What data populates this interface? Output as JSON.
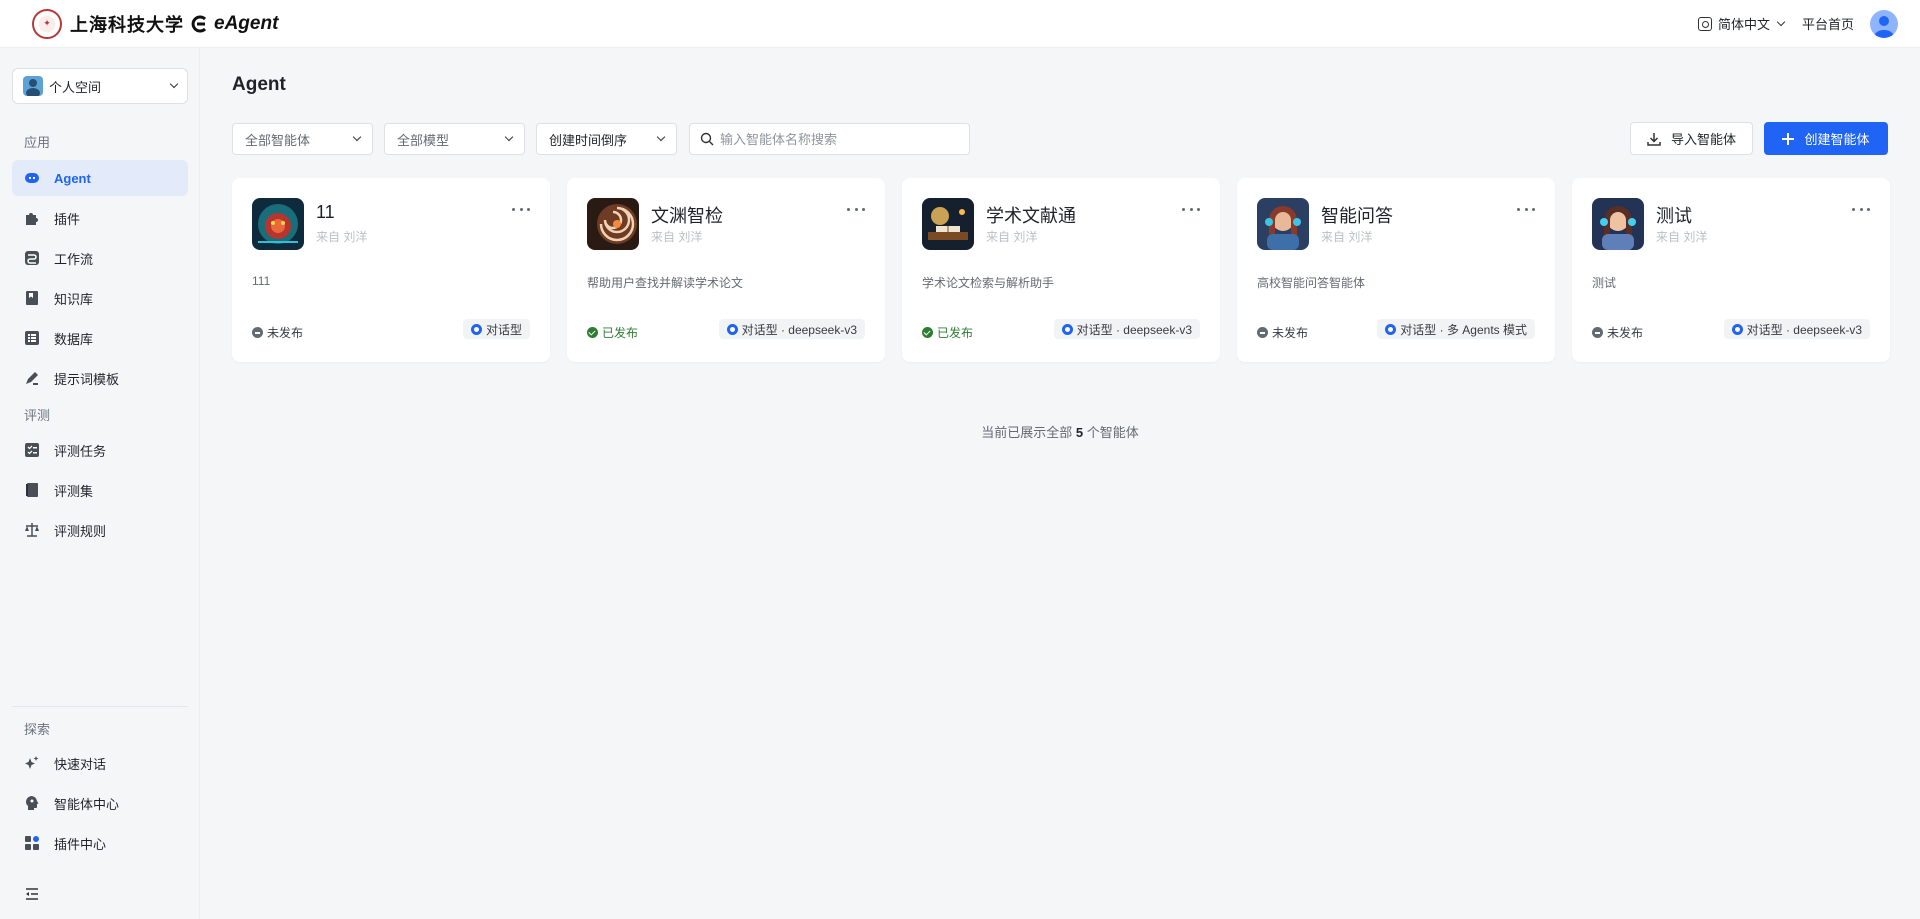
{
  "header": {
    "school_name": "上海科技大学",
    "product_name": "eAgent",
    "language": "简体中文",
    "home_link": "平台首页"
  },
  "sidebar": {
    "space_label": "个人空间",
    "section_app": "应用",
    "section_eval": "评测",
    "section_explore": "探索",
    "app_items": [
      {
        "label": "Agent",
        "icon": "robot-icon",
        "active": true
      },
      {
        "label": "插件",
        "icon": "puzzle-icon"
      },
      {
        "label": "工作流",
        "icon": "workflow-icon"
      },
      {
        "label": "知识库",
        "icon": "knowledge-icon"
      },
      {
        "label": "数据库",
        "icon": "database-icon"
      },
      {
        "label": "提示词模板",
        "icon": "prompt-icon"
      }
    ],
    "eval_items": [
      {
        "label": "评测任务",
        "icon": "eval-task-icon"
      },
      {
        "label": "评测集",
        "icon": "eval-set-icon"
      },
      {
        "label": "评测规则",
        "icon": "scale-icon"
      }
    ],
    "explore_items": [
      {
        "label": "快速对话",
        "icon": "sparkle-icon"
      },
      {
        "label": "智能体中心",
        "icon": "brain-icon"
      },
      {
        "label": "插件中心",
        "icon": "plugin-grid-icon"
      }
    ]
  },
  "main": {
    "title": "Agent",
    "filters": [
      "全部智能体",
      "全部模型",
      "创建时间倒序"
    ],
    "search_placeholder": "输入智能体名称搜索",
    "import_label": "导入智能体",
    "create_label": "创建智能体",
    "accent_color": "#1f64f5",
    "cards": [
      {
        "name": "11",
        "from": "来自 刘洋",
        "desc": "111",
        "status": "未发布",
        "published": false,
        "type": "对话型"
      },
      {
        "name": "文渊智检",
        "from": "来自 刘洋",
        "desc": "帮助用户查找并解读学术论文",
        "status": "已发布",
        "published": true,
        "type": "对话型 · deepseek-v3"
      },
      {
        "name": "学术文献通",
        "from": "来自 刘洋",
        "desc": "学术论文检索与解析助手",
        "status": "已发布",
        "published": true,
        "type": "对话型 · deepseek-v3"
      },
      {
        "name": "智能问答",
        "from": "来自 刘洋",
        "desc": "高校智能问答智能体",
        "status": "未发布",
        "published": false,
        "type": "对话型 · 多 Agents 模式"
      },
      {
        "name": "测试",
        "from": "来自 刘洋",
        "desc": "测试",
        "status": "未发布",
        "published": false,
        "type": "对话型 · deepseek-v3"
      }
    ],
    "footer_prefix": "当前已展示全部",
    "footer_count": "5",
    "footer_suffix": "个智能体"
  }
}
